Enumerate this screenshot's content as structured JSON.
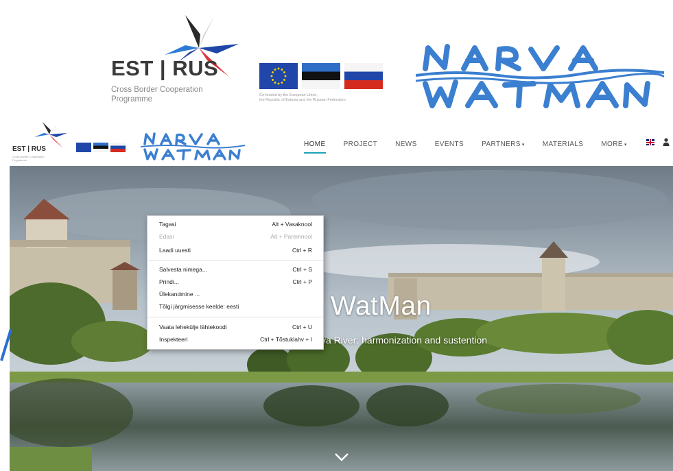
{
  "banner": {
    "est_rus_logo": {
      "name": "EST | RUS",
      "subtitle_line1": "Cross Border Cooperation",
      "subtitle_line2": "Programme"
    },
    "funding_caption_line1": "Co-funded by the European Union,",
    "funding_caption_line2": "the Republic of Estonia and the Russian Federation",
    "watman_logo": {
      "line1": "NARVA",
      "line2": "WATMAN",
      "color": "#3b7fd0"
    }
  },
  "nav": {
    "small_logo": {
      "name": "EST | RUS",
      "subtitle": "Cross Border Cooperation Programme"
    },
    "items": [
      {
        "label": "HOME",
        "active": true
      },
      {
        "label": "PROJECT"
      },
      {
        "label": "NEWS"
      },
      {
        "label": "EVENTS"
      },
      {
        "label": "PARTNERS",
        "caret": "▾"
      },
      {
        "label": "MATERIALS"
      },
      {
        "label": "MORE",
        "caret": "▾"
      }
    ],
    "accent_color": "#1aa4b8"
  },
  "hero": {
    "title": "WatMan",
    "subtitle": "va River: harmonization and sustention",
    "scroll_icon": "chevron-down-icon"
  },
  "context_menu": {
    "items": [
      {
        "label": "Tagasi",
        "shortcut": "Alt + Vasaknool"
      },
      {
        "label": "Edasi",
        "shortcut": "Alt + Paremnool",
        "disabled": true
      },
      {
        "label": "Laadi uuesti",
        "shortcut": "Ctrl + R"
      },
      {
        "label": "Salvesta nimega...",
        "shortcut": "Ctrl + S"
      },
      {
        "label": "Prindi...",
        "shortcut": "Ctrl + P"
      },
      {
        "label": "Ülekandmine ...",
        "shortcut": ""
      },
      {
        "label": "Tõlgi järgmisesse keelde: eesti",
        "shortcut": ""
      },
      {
        "label": "Vaata lehekülje lähtekoodi",
        "shortcut": "Ctrl + U"
      },
      {
        "label": "Inspekteeri",
        "shortcut": "Ctrl + Tõstuklahv + I"
      }
    ]
  }
}
